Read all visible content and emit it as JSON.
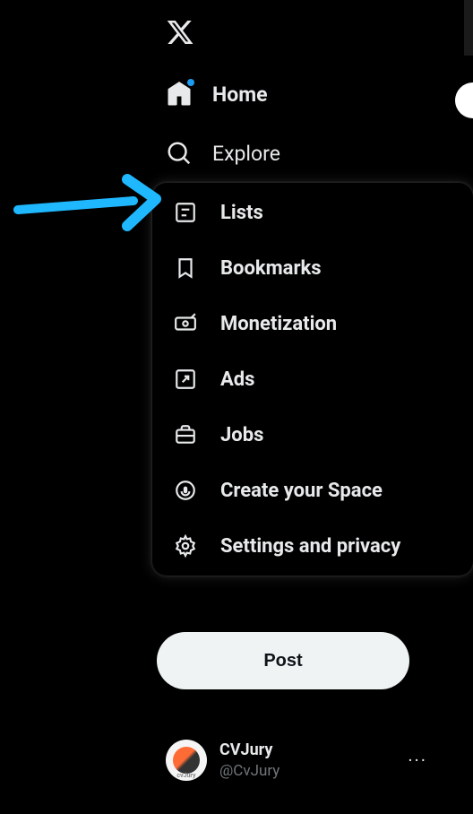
{
  "nav": {
    "home": "Home",
    "explore": "Explore"
  },
  "popup": {
    "lists": "Lists",
    "bookmarks": "Bookmarks",
    "monetization": "Monetization",
    "ads": "Ads",
    "jobs": "Jobs",
    "create_space": "Create your Space",
    "settings": "Settings and privacy"
  },
  "post_button": "Post",
  "profile": {
    "name": "CVJury",
    "handle": "@CvJury",
    "avatar_label": "cvJury"
  },
  "arrow_color": "#1fb8ff"
}
